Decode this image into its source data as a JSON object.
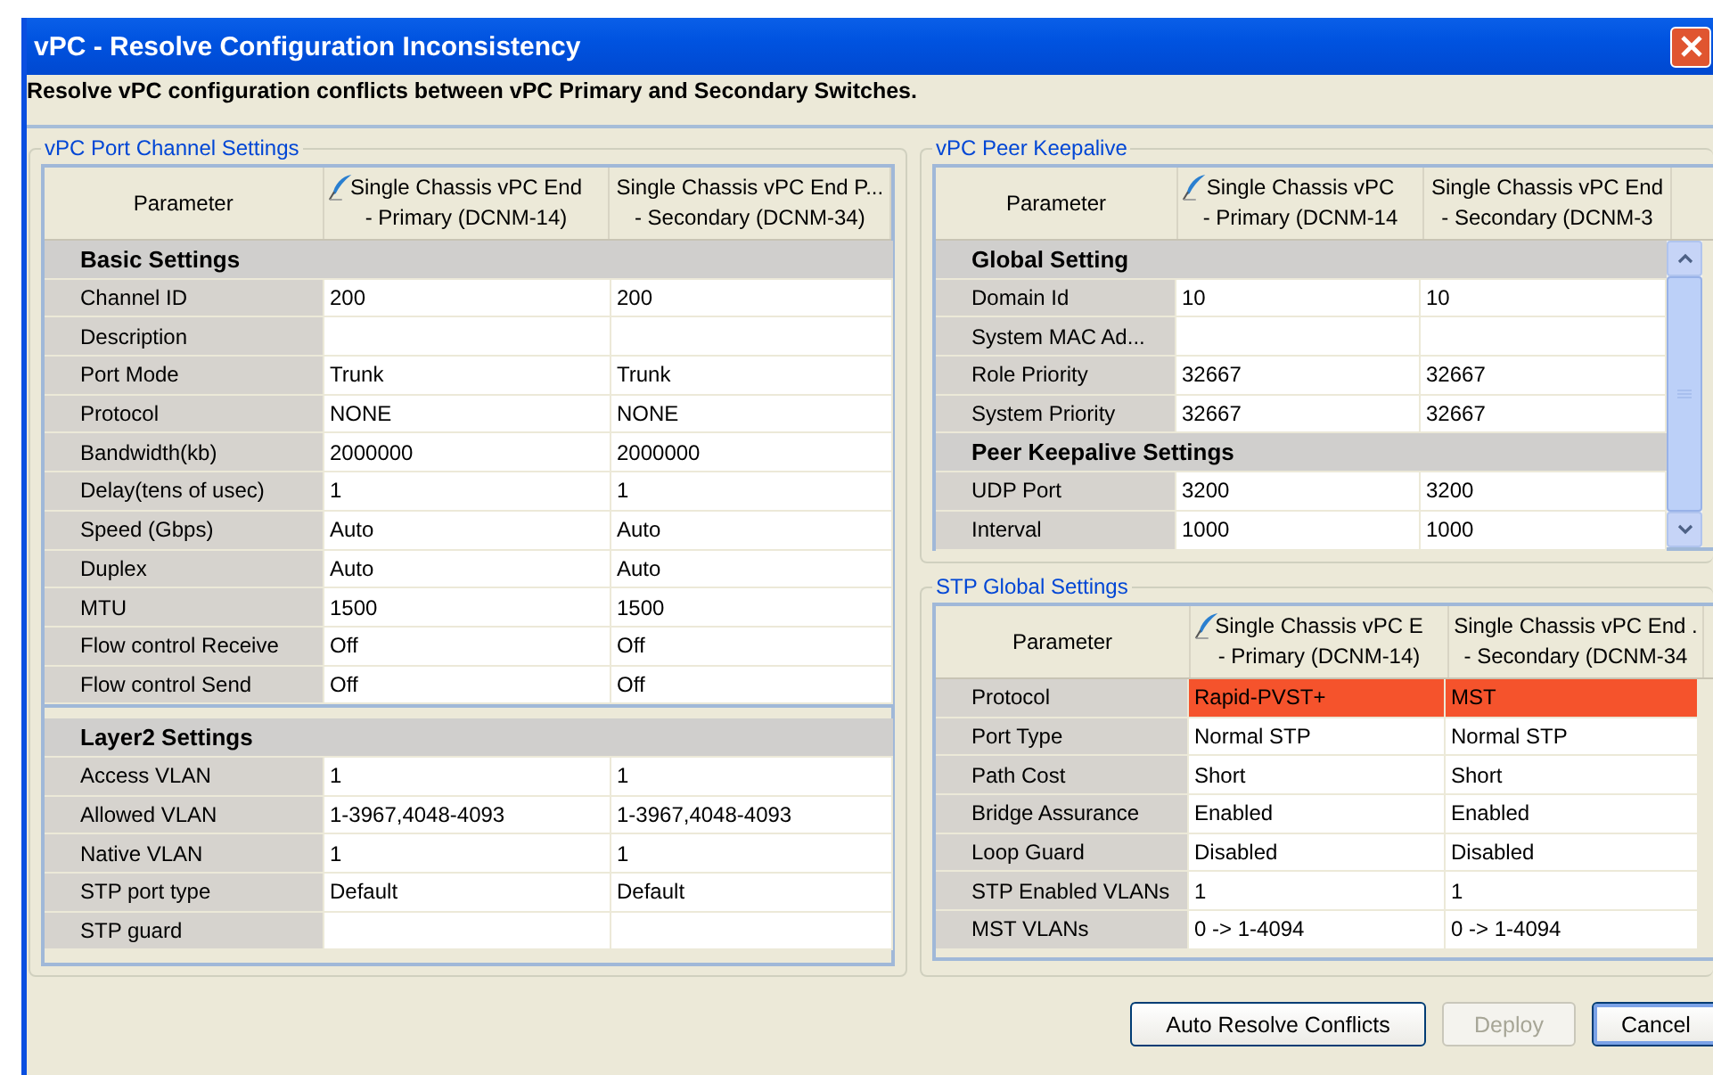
{
  "window": {
    "title": "vPC - Resolve Configuration Inconsistency"
  },
  "instruction": "Resolve vPC configuration conflicts between vPC Primary and Secondary Switches.",
  "panels": [
    {
      "title": "vPC Port Channel Settings",
      "scrollable": false,
      "header": {
        "parameter": "Parameter",
        "columns": [
          {
            "line1": "Single Chassis vPC End",
            "line2": "- Primary (DCNM-14)",
            "edited": true
          },
          {
            "line1": "Single Chassis vPC End P...",
            "line2": "- Secondary (DCNM-34)",
            "edited": false
          }
        ]
      },
      "sections": [
        [
          {
            "title": "Basic Settings",
            "rows": [
              {
                "parameter": "Channel ID",
                "values": [
                  "200",
                  "200"
                ],
                "conflict": false
              },
              {
                "parameter": "Description",
                "values": [],
                "conflict": false
              },
              {
                "parameter": "Port Mode",
                "values": [
                  "Trunk",
                  "Trunk"
                ],
                "conflict": false
              },
              {
                "parameter": "Protocol",
                "values": [
                  "NONE",
                  "NONE"
                ],
                "conflict": false
              },
              {
                "parameter": "Bandwidth(kb)",
                "values": [
                  "2000000",
                  "2000000"
                ],
                "conflict": false
              },
              {
                "parameter": "Delay(tens of usec)",
                "values": [
                  "1",
                  "1"
                ],
                "conflict": false
              },
              {
                "parameter": "Speed (Gbps)",
                "values": [
                  "Auto",
                  "Auto"
                ],
                "conflict": false
              },
              {
                "parameter": "Duplex",
                "values": [
                  "Auto",
                  "Auto"
                ],
                "conflict": false
              },
              {
                "parameter": "MTU",
                "values": [
                  "1500",
                  "1500"
                ],
                "conflict": false
              },
              {
                "parameter": "Flow control Receive",
                "values": [
                  "Off",
                  "Off"
                ],
                "conflict": false
              },
              {
                "parameter": "Flow control Send",
                "values": [
                  "Off",
                  "Off"
                ],
                "conflict": false
              }
            ]
          }
        ],
        [
          {
            "title": "Layer2 Settings",
            "rows": [
              {
                "parameter": "Access VLAN",
                "values": [
                  "1",
                  "1"
                ],
                "conflict": false
              },
              {
                "parameter": "Allowed VLAN",
                "values": [
                  "1-3967,4048-4093",
                  "1-3967,4048-4093"
                ],
                "conflict": false
              },
              {
                "parameter": "Native VLAN",
                "values": [
                  "1",
                  "1"
                ],
                "conflict": false
              },
              {
                "parameter": "STP port type",
                "values": [
                  "Default",
                  "Default"
                ],
                "conflict": false
              },
              {
                "parameter": "STP guard",
                "values": [],
                "conflict": false
              }
            ]
          }
        ]
      ]
    },
    {
      "title": "vPC Peer Keepalive",
      "scrollable": true,
      "header": {
        "parameter": "Parameter",
        "columns": [
          {
            "line1": "Single Chassis vPC",
            "line2": "- Primary (DCNM-14",
            "edited": true
          },
          {
            "line1": "Single Chassis vPC End",
            "line2": "- Secondary (DCNM-3",
            "edited": false
          }
        ]
      },
      "sections": [
        [
          {
            "title": "Global Setting",
            "rows": [
              {
                "parameter": "Domain Id",
                "values": [
                  "10",
                  "10"
                ],
                "conflict": false
              },
              {
                "parameter": "System MAC Ad...",
                "values": [],
                "conflict": false
              },
              {
                "parameter": "Role Priority",
                "values": [
                  "32667",
                  "32667"
                ],
                "conflict": false
              },
              {
                "parameter": "System Priority",
                "values": [
                  "32667",
                  "32667"
                ],
                "conflict": false
              }
            ]
          },
          {
            "title": "Peer Keepalive Settings",
            "rows": [
              {
                "parameter": "UDP Port",
                "values": [
                  "3200",
                  "3200"
                ],
                "conflict": false
              },
              {
                "parameter": "Interval",
                "values": [
                  "1000",
                  "1000"
                ],
                "conflict": false
              }
            ]
          }
        ]
      ]
    },
    {
      "title": "STP Global Settings",
      "scrollable": false,
      "header": {
        "parameter": "Parameter",
        "columns": [
          {
            "line1": "Single Chassis vPC E",
            "line2": "- Primary (DCNM-14)",
            "edited": true
          },
          {
            "line1": "Single Chassis vPC End .",
            "line2": "- Secondary (DCNM-34",
            "edited": false
          }
        ]
      },
      "sections": [
        [
          {
            "rows": [
              {
                "parameter": "Protocol",
                "values": [
                  "Rapid-PVST+",
                  "MST"
                ],
                "conflict": true
              },
              {
                "parameter": "Port Type",
                "values": [
                  "Normal STP",
                  "Normal STP"
                ],
                "conflict": false
              },
              {
                "parameter": "Path Cost",
                "values": [
                  "Short",
                  "Short"
                ],
                "conflict": false
              },
              {
                "parameter": "Bridge Assurance",
                "values": [
                  "Enabled",
                  "Enabled"
                ],
                "conflict": false
              },
              {
                "parameter": "Loop Guard",
                "values": [
                  "Disabled",
                  "Disabled"
                ],
                "conflict": false
              },
              {
                "parameter": "STP Enabled VLANs",
                "values": [
                  "1",
                  "1"
                ],
                "conflict": false
              },
              {
                "parameter": "MST VLANs",
                "values": [
                  "0 -> 1-4094",
                  "0 -> 1-4094"
                ],
                "conflict": false
              }
            ]
          }
        ]
      ]
    }
  ],
  "buttons": [
    {
      "label": "Auto Resolve Conflicts",
      "disabled": false,
      "focused": false
    },
    {
      "label": "Deploy",
      "disabled": true,
      "focused": false
    },
    {
      "label": "Cancel",
      "disabled": false,
      "focused": true
    }
  ]
}
